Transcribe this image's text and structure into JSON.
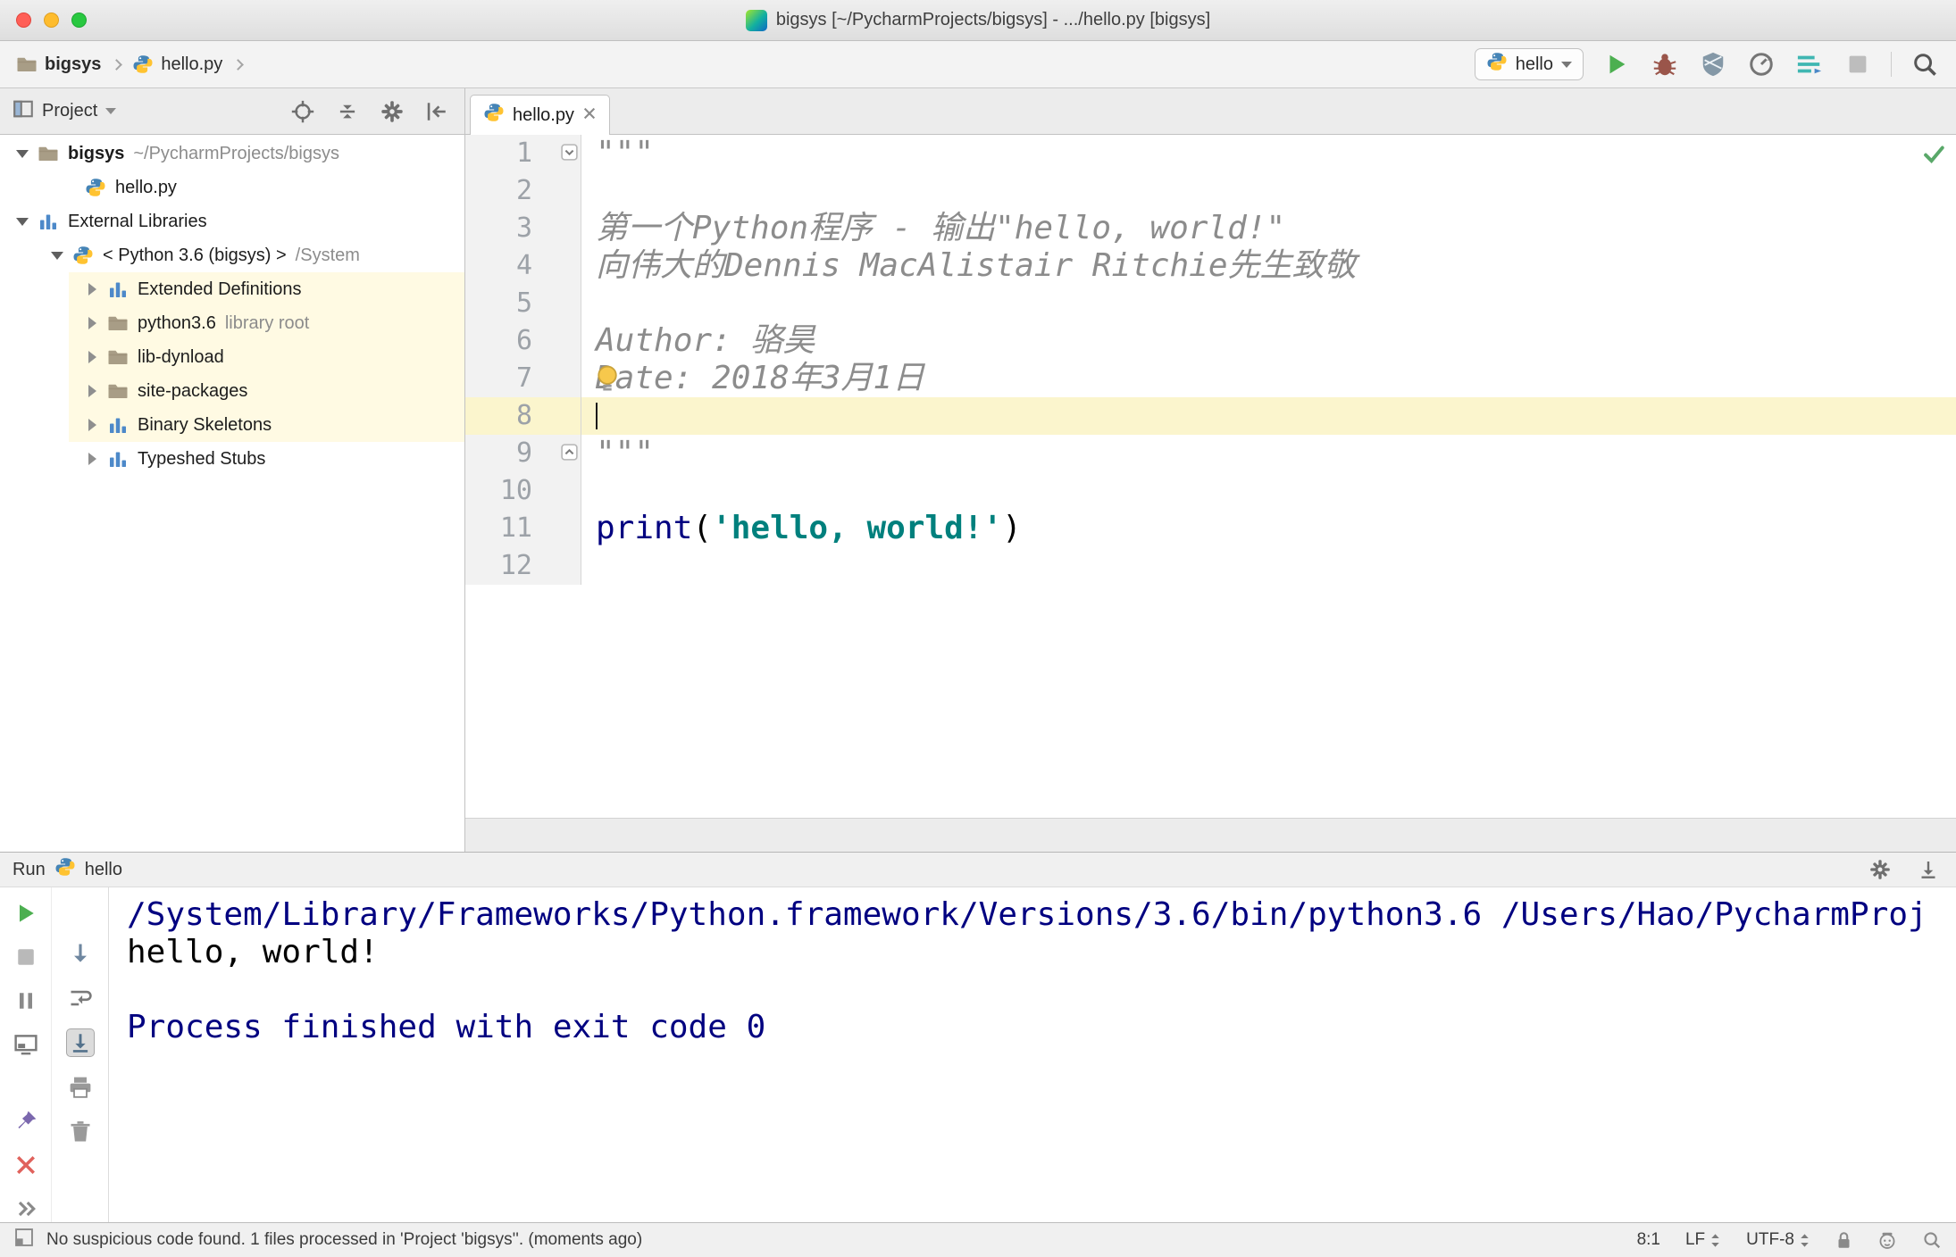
{
  "title_bar": {
    "title": "bigsys [~/PycharmProjects/bigsys] - .../hello.py [bigsys]"
  },
  "nav_bar": {
    "breadcrumbs": [
      {
        "label": "bigsys",
        "icon": "folder",
        "bold": true
      },
      {
        "label": "hello.py",
        "icon": "pyfile"
      }
    ],
    "run_config": {
      "label": "hello"
    }
  },
  "project_panel": {
    "title": "Project",
    "tree": [
      {
        "level": 0,
        "arrow": "down",
        "icon": "folder",
        "label": "bigsys",
        "suffix": "~/PycharmProjects/bigsys",
        "bold": true
      },
      {
        "level": 1,
        "arrow": "none",
        "icon": "pyfile",
        "label": "hello.py"
      },
      {
        "level": 0,
        "arrow": "down",
        "icon": "libs",
        "label": "External Libraries"
      },
      {
        "level": 1,
        "arrow": "down",
        "icon": "python",
        "label": "< Python 3.6 (bigsys) >",
        "suffix": "/System"
      },
      {
        "level": 2,
        "arrow": "right",
        "icon": "libs",
        "label": "Extended Definitions",
        "highlight": true
      },
      {
        "level": 2,
        "arrow": "right",
        "icon": "folder",
        "label": "python3.6",
        "suffix": "library root",
        "highlight": true
      },
      {
        "level": 2,
        "arrow": "right",
        "icon": "folder",
        "label": "lib-dynload",
        "highlight": true
      },
      {
        "level": 2,
        "arrow": "right",
        "icon": "folder",
        "label": "site-packages",
        "highlight": true
      },
      {
        "level": 2,
        "arrow": "right",
        "icon": "libs",
        "label": "Binary Skeletons",
        "highlight": true
      },
      {
        "level": 2,
        "arrow": "right",
        "icon": "libs",
        "label": "Typeshed Stubs"
      }
    ]
  },
  "editor": {
    "tab": {
      "label": "hello.py"
    },
    "caret_line": 8,
    "fold_start_line": 1,
    "fold_end_line": 9,
    "bulb_line": 7,
    "lines": [
      {
        "n": 1,
        "segs": [
          {
            "t": "\"\"\"",
            "s": "doc"
          }
        ]
      },
      {
        "n": 2,
        "segs": []
      },
      {
        "n": 3,
        "segs": [
          {
            "t": "第一个Python程序 - 输出\"hello, world!\"",
            "s": "doc"
          }
        ]
      },
      {
        "n": 4,
        "segs": [
          {
            "t": "向伟大的Dennis MacAlistair Ritchie先生致敬",
            "s": "doc"
          }
        ]
      },
      {
        "n": 5,
        "segs": []
      },
      {
        "n": 6,
        "segs": [
          {
            "t": "Author: 骆昊",
            "s": "doc"
          }
        ]
      },
      {
        "n": 7,
        "segs": [
          {
            "t": "Date: 2018年3月1日",
            "s": "doc"
          }
        ]
      },
      {
        "n": 8,
        "segs": []
      },
      {
        "n": 9,
        "segs": [
          {
            "t": "\"\"\"",
            "s": "doc"
          }
        ]
      },
      {
        "n": 10,
        "segs": []
      },
      {
        "n": 11,
        "segs": [
          {
            "t": "print",
            "s": "builtin"
          },
          {
            "t": "(",
            "s": "plain"
          },
          {
            "t": "'hello, world!'",
            "s": "string"
          },
          {
            "t": ")",
            "s": "plain"
          }
        ]
      },
      {
        "n": 12,
        "segs": []
      }
    ]
  },
  "run_panel": {
    "title": "Run",
    "config": "hello",
    "console": [
      {
        "text": "/System/Library/Frameworks/Python.framework/Versions/3.6/bin/python3.6 /Users/Hao/PycharmProj",
        "style": "system"
      },
      {
        "text": "hello, world!",
        "style": "stdout"
      },
      {
        "text": "",
        "style": "stdout"
      },
      {
        "text": "Process finished with exit code 0",
        "style": "system"
      }
    ]
  },
  "status_bar": {
    "message": "No suspicious code found. 1 files processed in 'Project 'bigsys''. (moments ago)",
    "caret_position": "8:1",
    "line_separator": "LF",
    "encoding": "UTF-8"
  },
  "colors": {
    "accent_blue": "#4d89c9",
    "run_green": "#4caf50",
    "tree_highlight": "#fffae3",
    "caret_line": "#fbf5cd",
    "console_system": "#000080",
    "string_teal": "#00807d",
    "doc_gray": "#8c8c8c"
  },
  "icons": {
    "pycharm-logo-icon": "gradient rounded square",
    "folder-icon": "folder glyph",
    "python-icon": "python two-tone logo",
    "libraries-icon": "blue bars",
    "run-icon": "green play triangle",
    "debug-icon": "bug",
    "coverage-icon": "shield",
    "profiler-icon": "dial with arrow",
    "stop-icon": "gray square",
    "search-icon": "magnifier",
    "gear-icon": "gear",
    "checkmark-icon": "green check",
    "lightbulb-icon": "yellow bulb",
    "trash-icon": "trash can",
    "printer-icon": "printer",
    "lock-icon": "padlock",
    "hector-icon": "inspector face"
  }
}
